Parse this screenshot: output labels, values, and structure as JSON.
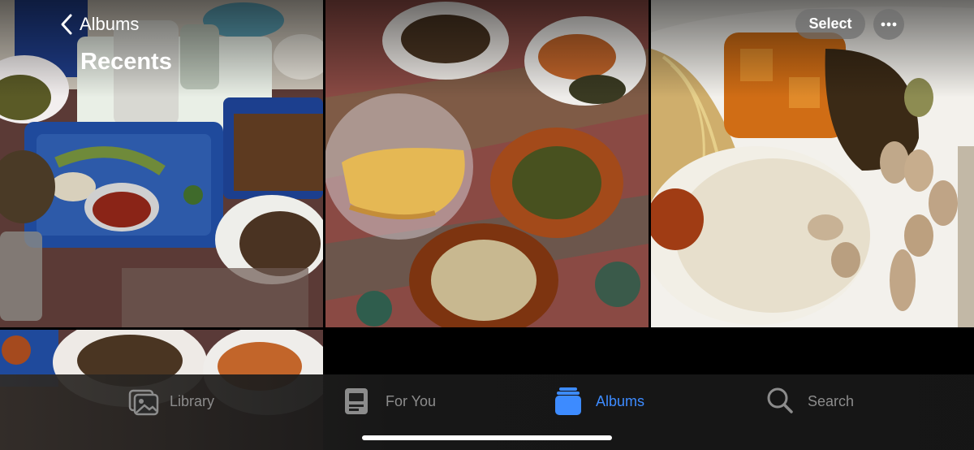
{
  "header": {
    "back_label": "Albums",
    "title": "Recents",
    "select_label": "Select",
    "more_icon": "ellipsis-icon"
  },
  "photos": [
    {
      "description_icon": "photo"
    },
    {
      "description_icon": "photo"
    },
    {
      "description_icon": "photo"
    },
    {
      "description_icon": "photo"
    }
  ],
  "tabbar": {
    "tabs": [
      {
        "label": "Library",
        "icon": "photo-library-icon",
        "active": false
      },
      {
        "label": "For You",
        "icon": "for-you-icon",
        "active": false
      },
      {
        "label": "Albums",
        "icon": "albums-icon",
        "active": true
      },
      {
        "label": "Search",
        "icon": "search-icon",
        "active": false
      }
    ]
  },
  "colors": {
    "accent": "#3d8bff",
    "inactive_tab": "#8c8c8c",
    "background": "#000000"
  }
}
